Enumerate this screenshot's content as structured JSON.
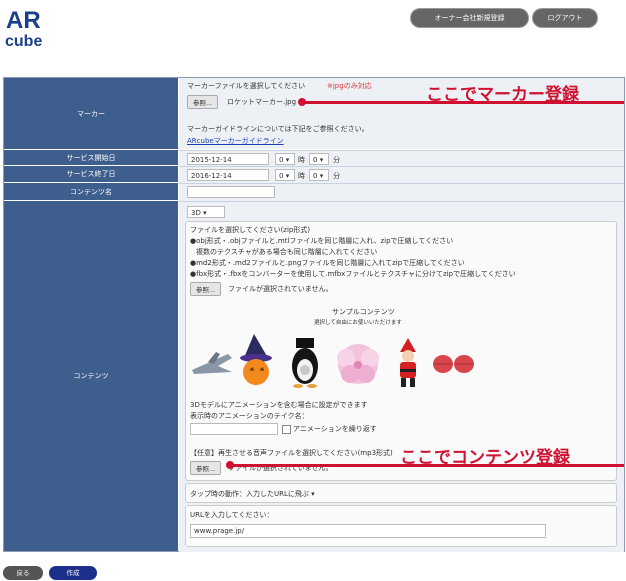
{
  "header": {
    "logo_top": "AR",
    "logo_bottom": "cube",
    "owner_register_label": "オーナー会社新規登録",
    "logout_label": "ログアウト"
  },
  "marker": {
    "label": "マーカー",
    "instruction": "マーカーファイルを選択してください",
    "instruction_note": "※jpgのみ対応",
    "browse_label": "参照...",
    "file_name": "ロケットマーカー.jpg",
    "guideline_text": "マーカーガイドラインについては下記をご参照ください。",
    "guideline_link": "ARcubeマーカーガイドライン"
  },
  "service_start": {
    "label": "サービス開始日",
    "date": "2015-12-14",
    "hour": "0",
    "hour_unit": "時",
    "minute": "0",
    "minute_unit": "分"
  },
  "service_end": {
    "label": "サービス終了日",
    "date": "2016-12-14",
    "hour": "0",
    "hour_unit": "時",
    "minute": "0",
    "minute_unit": "分"
  },
  "content_name": {
    "label": "コンテンツ名",
    "value": ""
  },
  "contents": {
    "label": "コンテンツ",
    "type": "3D",
    "file_instruction": "ファイルを選択してください(zip形式)",
    "rule_obj": "●obj形式・.objファイルと.mtlファイルを同じ階層に入れ、zipで圧縮してください",
    "rule_obj_2": "複数のテクスチャがある場合も同じ階層に入れてください",
    "rule_md2": "●md2形式・.md2ファイルと.pngファイルを同じ階層に入れてzipで圧縮してください",
    "rule_fbx": "●fbx形式・.fbxをコンバーターを使用して.mfbxファイルとテクスチャに分けてzipで圧縮してください",
    "browse_label": "参照...",
    "no_file": "ファイルが選択されていません。",
    "sample_title": "サンプルコンテンツ",
    "sample_subtitle": "選択して自由にお使いいただけます",
    "anim_note": "3Dモデルにアニメーションを含む場合に設定ができます",
    "anim_take": "表示時のアニメーションのテイク名：",
    "anim_loop": "アニメーションを繰り返す",
    "audio_instruction": "【任意】再生させる音声ファイルを選択してください(mp3形式)",
    "audio_browse": "参照...",
    "audio_no_file": "ファイルが選択されていません。",
    "tap_action_label": "タップ時の動作：",
    "tap_action_value": "入力したURLに飛ぶ",
    "url_prompt": "URLを入力してください：",
    "url_value": "www.prage.jp/"
  },
  "annotations": {
    "marker_callout": "ここでマーカー登録",
    "content_callout": "ここでコンテンツ登録"
  },
  "footer": {
    "back_label": "戻る",
    "create_label": "作成"
  },
  "colors": {
    "label_bg": "#3e5f8d",
    "annotation": "#d01030",
    "create_button": "#1c2f8a",
    "back_button": "#555555"
  }
}
